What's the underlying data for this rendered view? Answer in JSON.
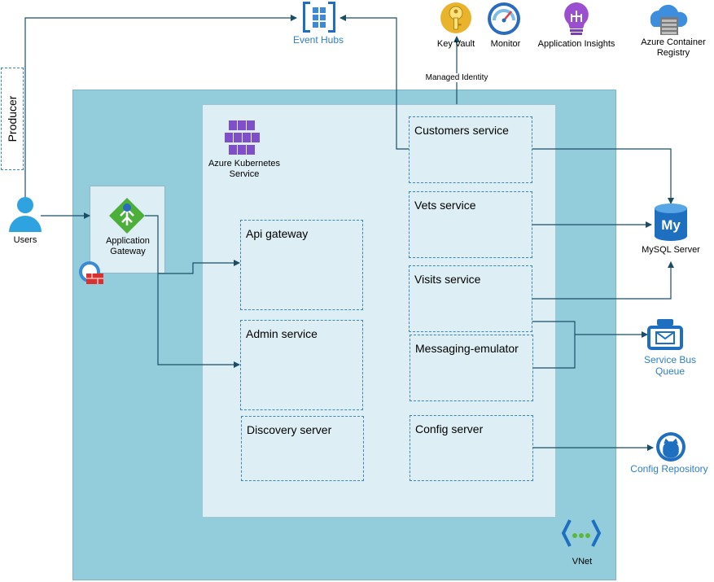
{
  "producer": "Producer",
  "users": "Users",
  "event_hubs": "Event Hubs",
  "key_vault": "Key Vault",
  "monitor": "Monitor",
  "app_insights": "Application Insights",
  "acr": [
    "Azure Container",
    "Registry"
  ],
  "managed_identity": "Managed Identity",
  "aks": [
    "Azure Kubernetes",
    "Service"
  ],
  "app_gateway": [
    "Application",
    "Gateway"
  ],
  "services": {
    "api_gateway": "Api gateway",
    "admin_service": "Admin service",
    "discovery_server": "Discovery server",
    "customers_service": "Customers service",
    "vets_service": "Vets service",
    "visits_service": "Visits service",
    "messaging_emulator": "Messaging-emulator",
    "config_server": "Config server"
  },
  "mysql": "MySQL Server",
  "service_bus": [
    "Service Bus",
    "Queue"
  ],
  "config_repo": "Config Repository",
  "vnet": "VNet",
  "colors": {
    "vnet_bg": "#93cddb",
    "aks_bg": "#ddeef4",
    "line": "#1b4e66",
    "dash": "#3a85c6",
    "link_text": "#2f7fc4"
  }
}
